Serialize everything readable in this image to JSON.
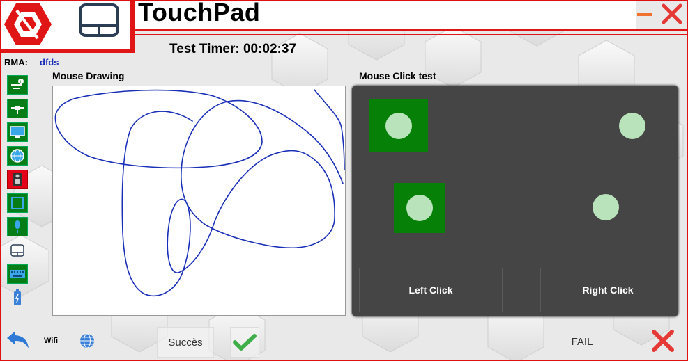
{
  "app": {
    "title": "TouchPad"
  },
  "timer": {
    "label": "Test Timer: 00:02:37"
  },
  "rma": {
    "label": "RMA:",
    "value": "dfds"
  },
  "sidebar": {
    "items": [
      {
        "icon": "system-info-icon",
        "style": "green"
      },
      {
        "icon": "network-icon",
        "style": "green"
      },
      {
        "icon": "monitor-icon",
        "style": "green"
      },
      {
        "icon": "globe-icon",
        "style": "green"
      },
      {
        "icon": "speaker-icon",
        "style": "red"
      },
      {
        "icon": "display-square-icon",
        "style": "green"
      },
      {
        "icon": "microphone-icon",
        "style": "green"
      },
      {
        "icon": "touchpad-icon",
        "style": "plain"
      },
      {
        "icon": "keyboard-icon",
        "style": "green"
      },
      {
        "icon": "battery-icon",
        "style": "plain"
      }
    ]
  },
  "drawing": {
    "title": "Mouse Drawing"
  },
  "click_test": {
    "title": "Mouse Click test",
    "left_label": "Left Click",
    "right_label": "Right Click"
  },
  "bottom": {
    "wifi_label": "Wifi",
    "success_label": "Succès",
    "fail_label": "FAIL"
  },
  "colors": {
    "accent_red": "#e01515",
    "pass_green": "#077d18",
    "stroke_blue": "#1a2fb8",
    "panel_dark": "#454545"
  }
}
